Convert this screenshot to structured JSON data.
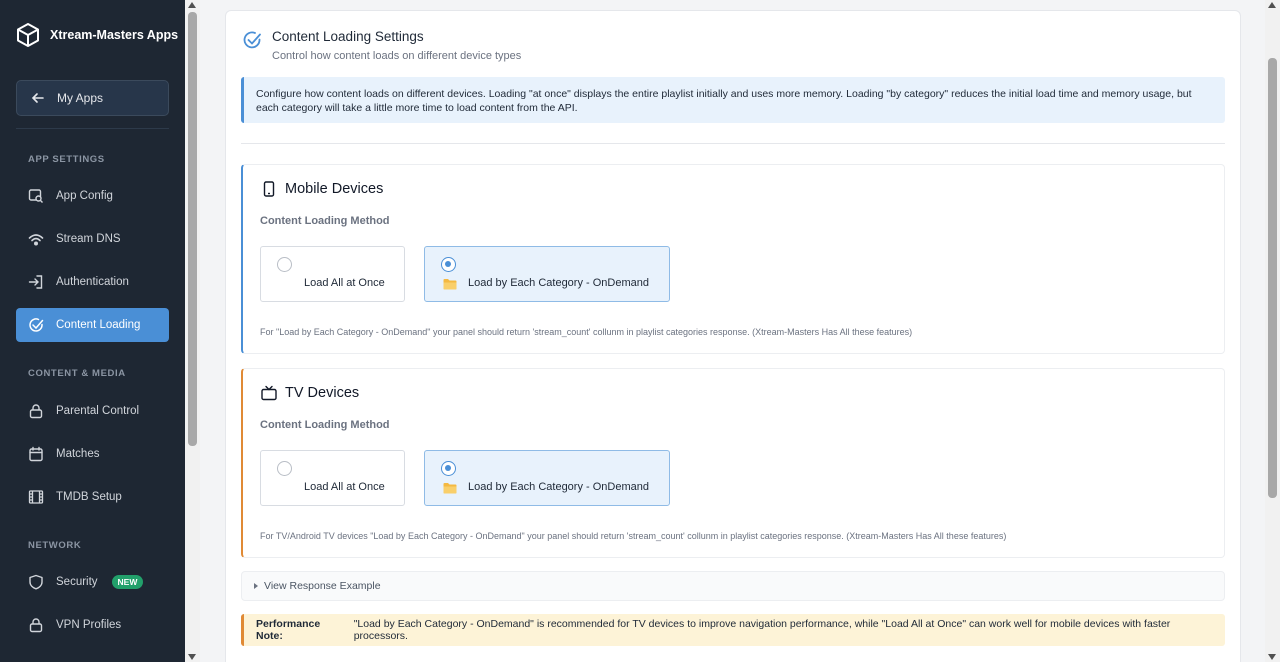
{
  "sidebar": {
    "brand": "Xtream-Masters Apps",
    "my_apps": "My Apps",
    "sections": {
      "app_settings": "APP SETTINGS",
      "content_media": "CONTENT & MEDIA",
      "network": "NETWORK"
    },
    "items": {
      "app_config": "App Config",
      "stream_dns": "Stream DNS",
      "authentication": "Authentication",
      "content_loading": "Content Loading",
      "parental_control": "Parental Control",
      "matches": "Matches",
      "tmdb_setup": "TMDB Setup",
      "security": "Security",
      "security_badge": "NEW",
      "vpn_profiles": "VPN Profiles"
    },
    "active_item": "content_loading"
  },
  "main": {
    "title": "Content Loading Settings",
    "subtitle": "Control how content loads on different device types",
    "info": "Configure how content loads on different devices. Loading \"at once\" displays the entire playlist initially and uses more memory. Loading \"by category\" reduces the initial load time and memory usage, but each category will take a little more time to load content from the API.",
    "mobile": {
      "title": "Mobile Devices",
      "method_label": "Content Loading Method",
      "option_all": "Load All at Once",
      "option_category": "Load by Each Category - OnDemand",
      "selected": "category",
      "note": "For \"Load by Each Category - OnDemand\" your panel should return 'stream_count' collunm in playlist categories response. (Xtream-Masters Has All these features)"
    },
    "tv": {
      "title": "TV Devices",
      "method_label": "Content Loading Method",
      "option_all": "Load All at Once",
      "option_category": "Load by Each Category - OnDemand",
      "selected": "category",
      "note": "For TV/Android TV devices \"Load by Each Category - OnDemand\" your panel should return 'stream_count' collunm in playlist categories response. (Xtream-Masters Has All these features)"
    },
    "response_example": "View Response Example",
    "performance": {
      "label": "Performance Note:",
      "text": "\"Load by Each Category - OnDemand\" is recommended for TV devices to improve navigation performance, while \"Load All at Once\" can work well for mobile devices with faster processors."
    }
  },
  "colors": {
    "sidebar_bg": "#1e2733",
    "accent": "#4a8fd6",
    "tv_accent": "#e08a35",
    "badge": "#22a06b"
  }
}
